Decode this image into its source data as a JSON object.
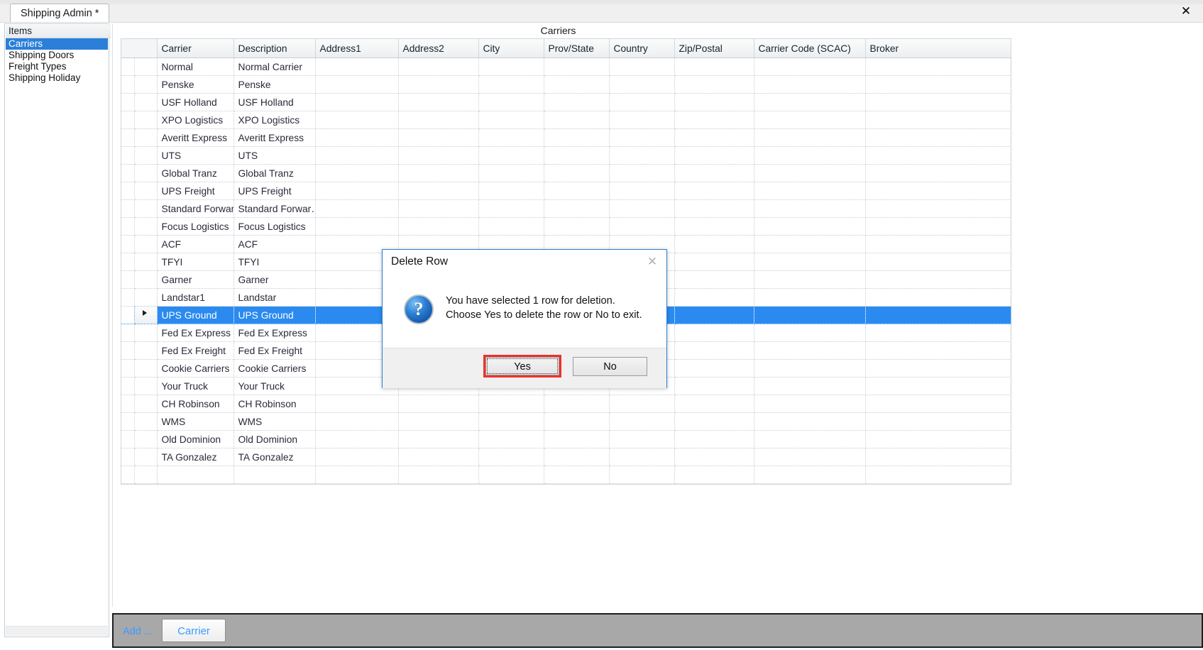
{
  "window": {
    "tab_label": "Shipping Admin *",
    "close_label": "✕"
  },
  "sidebar": {
    "header": "Items",
    "items": [
      {
        "label": "Carriers",
        "selected": true
      },
      {
        "label": "Shipping Doors",
        "selected": false
      },
      {
        "label": "Freight Types",
        "selected": false
      },
      {
        "label": "Shipping Holiday",
        "selected": false
      }
    ]
  },
  "main": {
    "grid_title": "Carriers",
    "columns": [
      "Carrier",
      "Description",
      "Address1",
      "Address2",
      "City",
      "Prov/State",
      "Country",
      "Zip/Postal",
      "Carrier Code (SCAC)",
      "Broker"
    ],
    "rows": [
      {
        "carrier": "Normal",
        "description": "Normal Carrier",
        "selected": false
      },
      {
        "carrier": "Penske",
        "description": "Penske",
        "selected": false
      },
      {
        "carrier": "USF Holland",
        "description": "USF Holland",
        "selected": false
      },
      {
        "carrier": "XPO Logistics",
        "description": "XPO Logistics",
        "selected": false
      },
      {
        "carrier": "Averitt Express",
        "description": "Averitt Express",
        "selected": false
      },
      {
        "carrier": "UTS",
        "description": "UTS",
        "selected": false
      },
      {
        "carrier": "Global Tranz",
        "description": "Global Tranz",
        "selected": false
      },
      {
        "carrier": "UPS Freight",
        "description": "UPS Freight",
        "selected": false
      },
      {
        "carrier": "Standard  Forwar…",
        "description": "Standard  Forwar…",
        "selected": false
      },
      {
        "carrier": "Focus Logistics",
        "description": "Focus Logistics",
        "selected": false
      },
      {
        "carrier": "ACF",
        "description": "ACF",
        "selected": false
      },
      {
        "carrier": "TFYI",
        "description": "TFYI",
        "selected": false
      },
      {
        "carrier": "Garner",
        "description": "Garner",
        "selected": false
      },
      {
        "carrier": "Landstar1",
        "description": "Landstar",
        "selected": false
      },
      {
        "carrier": "UPS Ground",
        "description": "UPS Ground",
        "selected": true
      },
      {
        "carrier": "Fed Ex Express",
        "description": "Fed Ex Express",
        "selected": false
      },
      {
        "carrier": "Fed Ex Freight",
        "description": "Fed Ex Freight",
        "selected": false
      },
      {
        "carrier": "Cookie Carriers",
        "description": "Cookie Carriers",
        "selected": false
      },
      {
        "carrier": "Your Truck",
        "description": "Your Truck",
        "selected": false
      },
      {
        "carrier": "CH Robinson",
        "description": "CH Robinson",
        "selected": false
      },
      {
        "carrier": "WMS",
        "description": "WMS",
        "selected": false
      },
      {
        "carrier": "Old Dominion",
        "description": "Old Dominion",
        "selected": false
      },
      {
        "carrier": "TA Gonzalez",
        "description": "TA Gonzalez",
        "selected": false
      },
      {
        "carrier": "",
        "description": "",
        "selected": false
      }
    ]
  },
  "bottom_toolbar": {
    "add_label": "Add ...",
    "carrier_button": "Carrier"
  },
  "dialog": {
    "title": "Delete Row",
    "close_label": "✕",
    "icon": "question-mark",
    "message_line1": "You have selected 1 row for deletion.",
    "message_line2": "Choose Yes to delete the row or No to exit.",
    "yes_label": "Yes",
    "no_label": "No",
    "focus_highlight_color": "#f1302a"
  },
  "colors": {
    "selection_blue": "#2b8aef",
    "sidebar_selection": "#2b7fd9",
    "link_blue": "#3b9bff",
    "toolbar_gray": "#a8a8a8"
  }
}
